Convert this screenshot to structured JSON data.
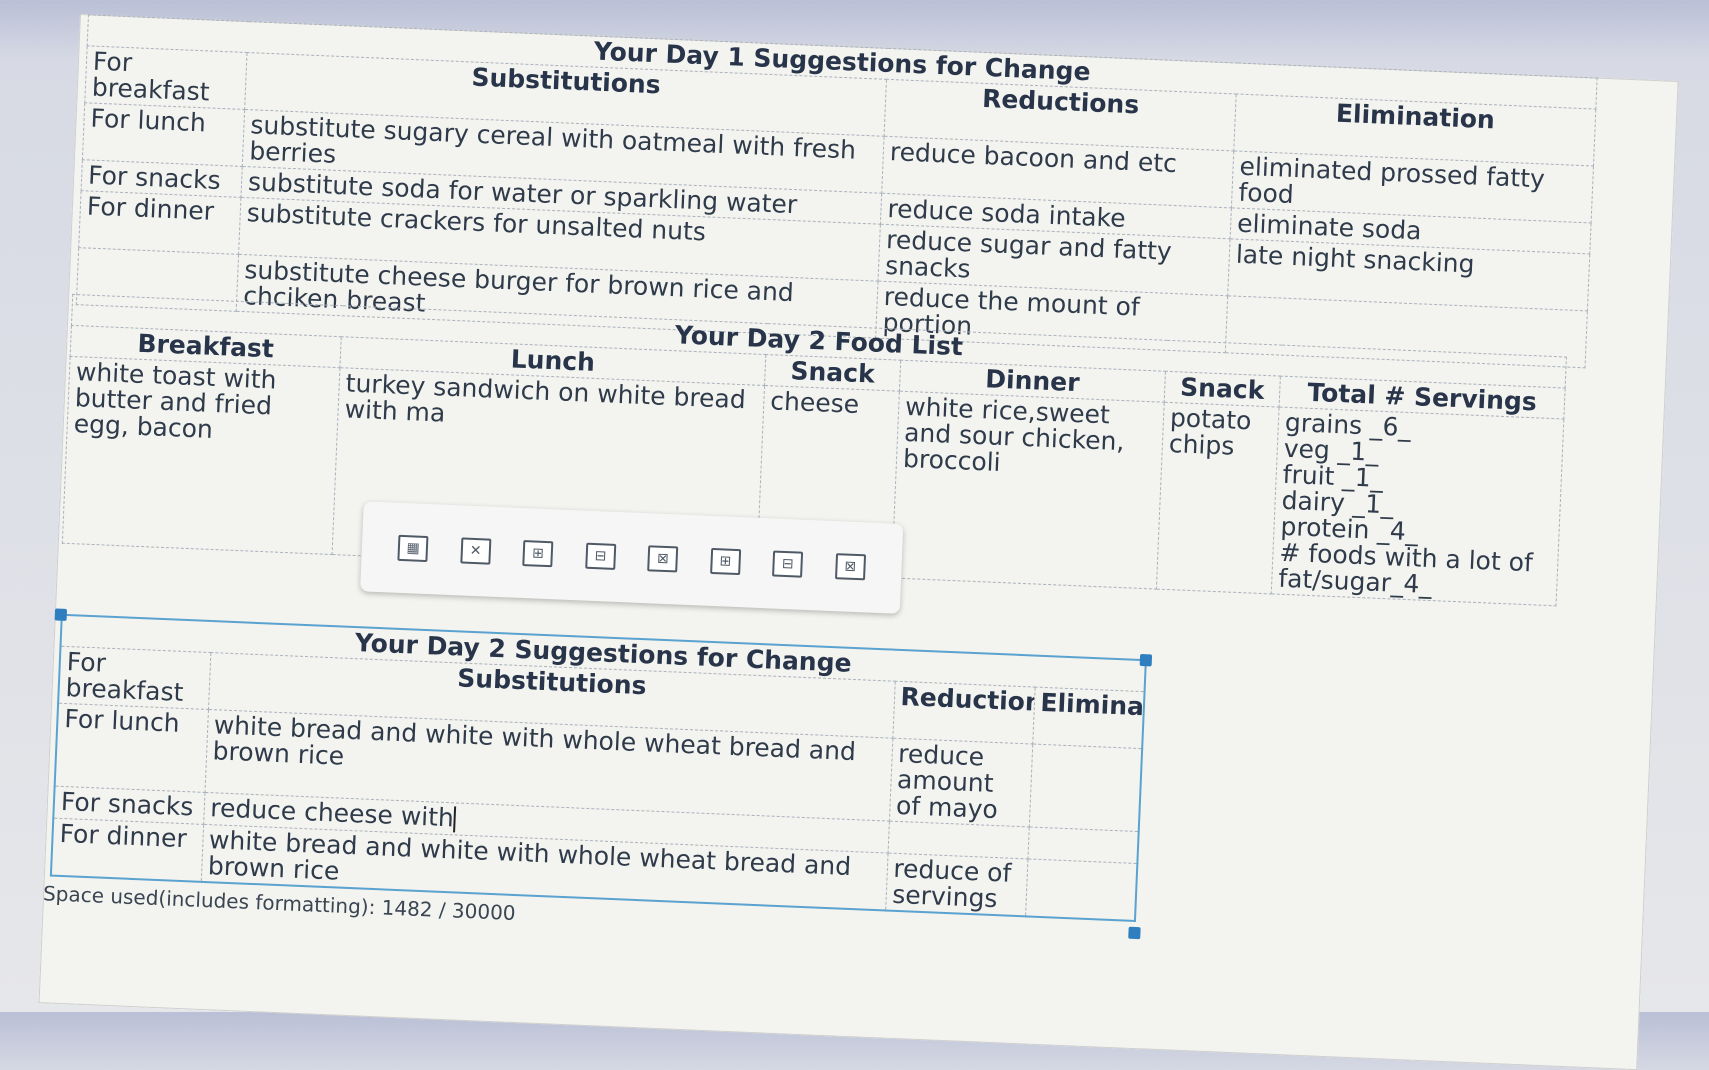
{
  "day1": {
    "title": "Your Day 1 Suggestions for Change",
    "headers": {
      "substitutions": "Substitutions",
      "reductions": "Reductions",
      "elimination": "Elimination"
    },
    "rows": [
      {
        "label": "For breakfast",
        "substitution": "substitute sugary cereal with oatmeal with fresh berries",
        "reduction": "reduce bacoon and etc",
        "elimination": "eliminated prossed fatty food"
      },
      {
        "label": "For lunch",
        "substitution": "substitute soda for water or sparkling water",
        "reduction": "reduce soda intake",
        "elimination": "eliminate soda"
      },
      {
        "label": "For snacks",
        "substitution": "substitute crackers for unsalted nuts",
        "reduction": "reduce sugar and fatty snacks",
        "elimination": "late night snacking"
      },
      {
        "label": "For dinner",
        "substitution": "substitute  cheese burger for brown rice and chciken breast",
        "reduction": "reduce the mount of portion",
        "elimination": ""
      }
    ]
  },
  "day2food": {
    "title": "Your Day 2 Food List",
    "headers": {
      "breakfast": "Breakfast",
      "lunch": "Lunch",
      "snack1": "Snack",
      "dinner": "Dinner",
      "snack2": "Snack",
      "total": "Total # Servings"
    },
    "row": {
      "breakfast": "white toast with butter and fried egg, bacon",
      "lunch": "turkey sandwich on white bread with ma",
      "snack1": "cheese",
      "dinner": "white rice,sweet and sour chicken, broccoli",
      "snack2": "potato chips",
      "servings": [
        "grains _6_",
        "veg _1_",
        "fruit _1_",
        "dairy _1_",
        "protein _4_"
      ],
      "fatsugar": "# foods with a lot of fat/sugar_4_"
    }
  },
  "day2sugg": {
    "title": "Your Day 2 Suggestions for Change",
    "headers": {
      "substitutions": "Substitutions",
      "reductions": "Reductions",
      "elimination": "Elimination"
    },
    "rows": [
      {
        "label": "For breakfast",
        "substitution": "",
        "reduction": "",
        "elimination": ""
      },
      {
        "label": "For lunch",
        "substitution": "white bread and white with whole wheat bread and brown rice",
        "reduction": "reduce amount of mayo",
        "elimination": ""
      },
      {
        "label": "For snacks",
        "substitution": "reduce cheese with",
        "reduction": "",
        "elimination": ""
      },
      {
        "label": "For dinner",
        "substitution": "white bread and white with whole wheat bread and brown rice",
        "reduction": "reduce of servings",
        "elimination": ""
      }
    ]
  },
  "footer": {
    "space_used": "Space used(includes formatting): 1482 / 30000"
  },
  "toolbar": {
    "icons": [
      "insert-table-icon",
      "delete-table-icon",
      "insert-row-above-icon",
      "insert-row-below-icon",
      "delete-row-icon",
      "insert-column-left-icon",
      "insert-column-right-icon",
      "delete-column-icon"
    ]
  }
}
